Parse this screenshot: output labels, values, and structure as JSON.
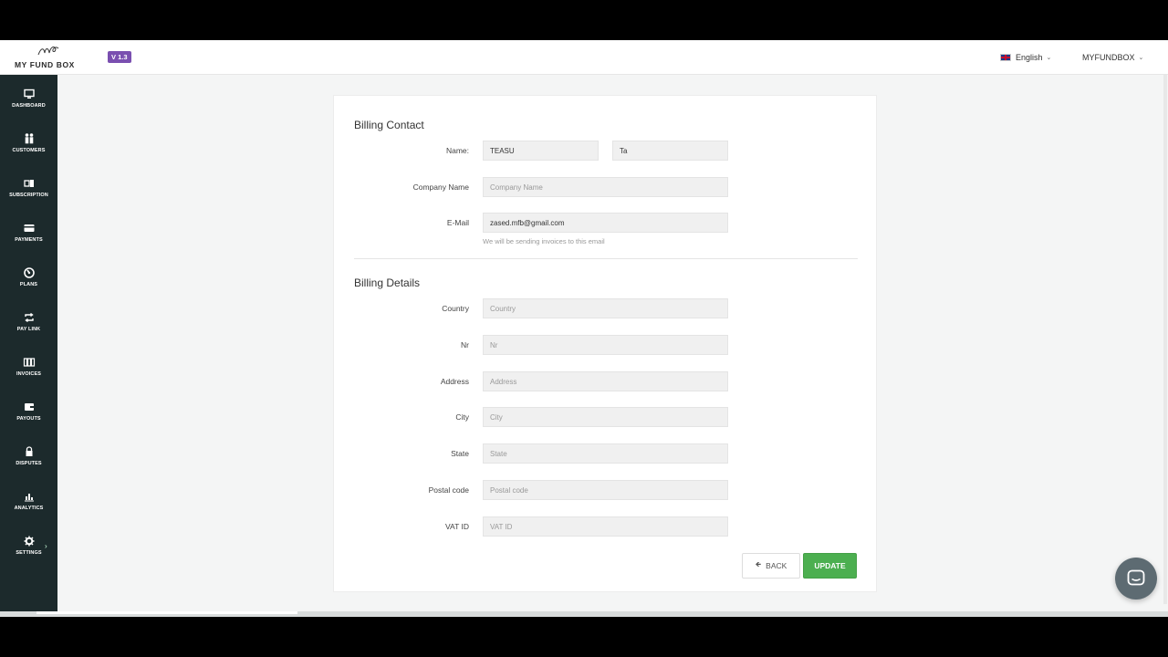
{
  "header": {
    "logo_text": "MY FUND BOX",
    "version": "V 1.3",
    "language": "English",
    "account": "MYFUNDBOX"
  },
  "sidebar": {
    "items": [
      {
        "label": "DASHBOARD",
        "icon": "monitor-icon"
      },
      {
        "label": "CUSTOMERS",
        "icon": "users-icon"
      },
      {
        "label": "SUBSCRIPTION",
        "icon": "subscription-icon"
      },
      {
        "label": "PAYMENTS",
        "icon": "credit-card-icon"
      },
      {
        "label": "PLANS",
        "icon": "plans-icon"
      },
      {
        "label": "PAY LINK",
        "icon": "repeat-icon"
      },
      {
        "label": "INVOICES",
        "icon": "invoices-icon"
      },
      {
        "label": "PAYOUTS",
        "icon": "wallet-icon"
      },
      {
        "label": "DISPUTES",
        "icon": "lock-icon"
      },
      {
        "label": "ANALYTICS",
        "icon": "bar-chart-icon"
      },
      {
        "label": "SETTINGS",
        "icon": "gear-icon"
      }
    ]
  },
  "billing_contact": {
    "title": "Billing Contact",
    "name_label": "Name:",
    "first_name": "TEASU",
    "last_name": "Ta",
    "company_label": "Company Name",
    "company_placeholder": "Company Name",
    "email_label": "E-Mail",
    "email": "zased.mfb@gmail.com",
    "email_hint": "We will be sending invoices to this email"
  },
  "billing_details": {
    "title": "Billing Details",
    "fields": [
      {
        "label": "Country",
        "placeholder": "Country"
      },
      {
        "label": "Nr",
        "placeholder": "Nr"
      },
      {
        "label": "Address",
        "placeholder": "Address"
      },
      {
        "label": "City",
        "placeholder": "City"
      },
      {
        "label": "State",
        "placeholder": "State"
      },
      {
        "label": "Postal code",
        "placeholder": "Postal code"
      },
      {
        "label": "VAT ID",
        "placeholder": "VAT ID"
      }
    ]
  },
  "actions": {
    "back_label": "BACK",
    "update_label": "UPDATE"
  },
  "colors": {
    "sidebar_bg": "#1c2a2c",
    "update_green": "#4caf50",
    "version_purple": "#7a4fb0"
  }
}
